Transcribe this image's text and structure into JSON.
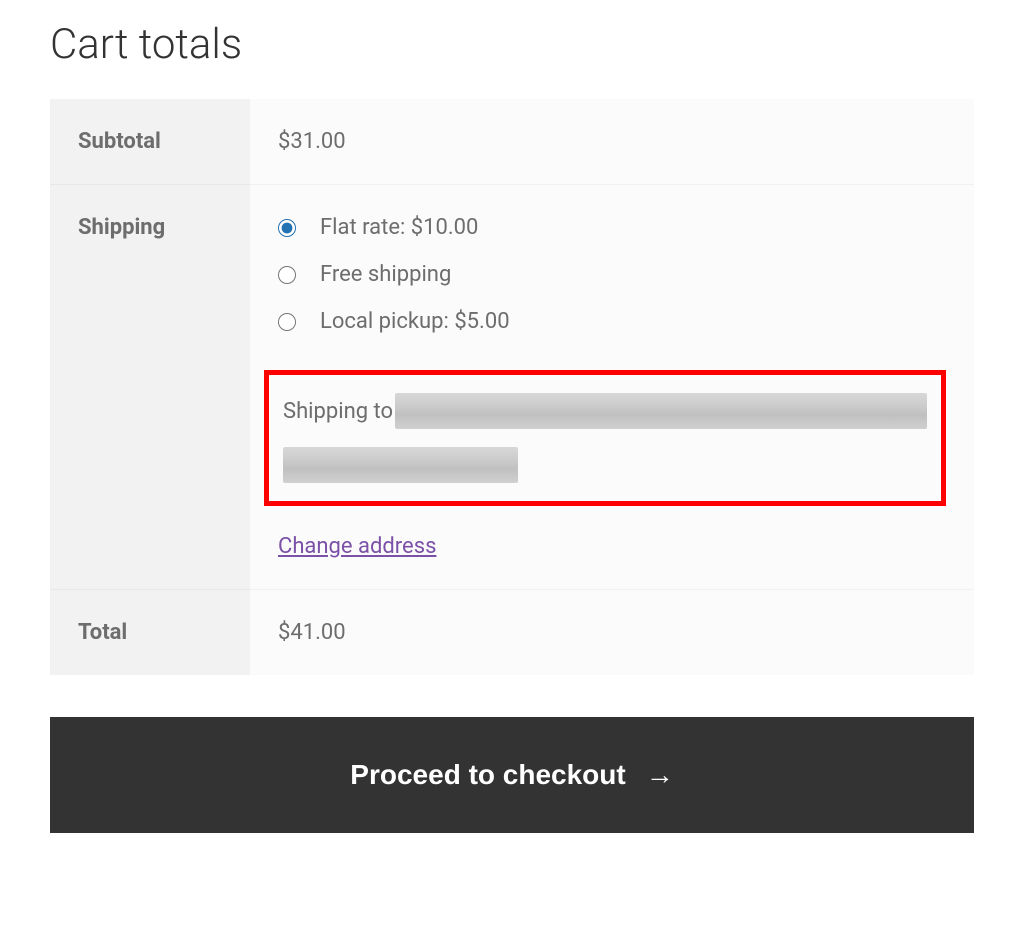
{
  "title": "Cart totals",
  "subtotal": {
    "label": "Subtotal",
    "value": "$31.00"
  },
  "shipping": {
    "label": "Shipping",
    "options": [
      {
        "label": "Flat rate: $10.00",
        "selected": true
      },
      {
        "label": "Free shipping",
        "selected": false
      },
      {
        "label": "Local pickup: $5.00",
        "selected": false
      }
    ],
    "shipping_to_label": "Shipping to",
    "change_address": "Change address"
  },
  "total": {
    "label": "Total",
    "value": "$41.00"
  },
  "checkout_button": "Proceed to checkout"
}
